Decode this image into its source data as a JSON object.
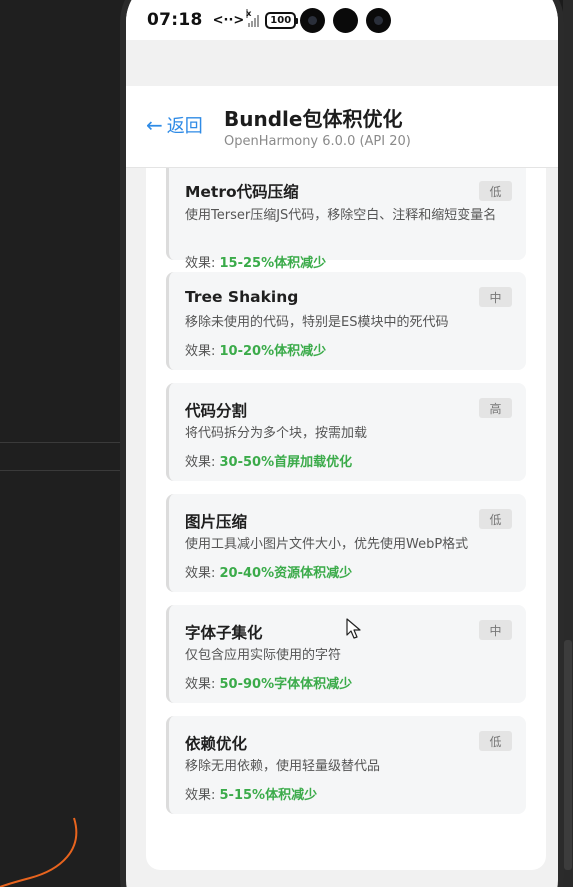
{
  "status_bar": {
    "time": "07:18",
    "nfc_icon": "<··>",
    "battery": "100"
  },
  "header": {
    "back_label": "返回",
    "title": "Bundle包体积优化",
    "subtitle": "OpenHarmony 6.0.0 (API 20)"
  },
  "effect_prefix": "效果: ",
  "items": [
    {
      "title": "Metro代码压缩",
      "badge": "低",
      "description": "使用Terser压缩JS代码，移除空白、注释和缩短变量名",
      "effect": "15-25%体积减少"
    },
    {
      "title": "Tree Shaking",
      "badge": "中",
      "description": "移除未使用的代码，特别是ES模块中的死代码",
      "effect": "10-20%体积减少"
    },
    {
      "title": "代码分割",
      "badge": "高",
      "description": "将代码拆分为多个块，按需加载",
      "effect": "30-50%首屏加载优化"
    },
    {
      "title": "图片压缩",
      "badge": "低",
      "description": "使用工具减小图片文件大小，优先使用WebP格式",
      "effect": "20-40%资源体积减少"
    },
    {
      "title": "字体子集化",
      "badge": "中",
      "description": "仅包含应用实际使用的字符",
      "effect": "50-90%字体体积减少"
    },
    {
      "title": "依赖优化",
      "badge": "低",
      "description": "移除无用依赖，使用轻量级替代品",
      "effect": "5-15%体积减少"
    }
  ],
  "colors": {
    "accent": "#2f8be6",
    "effect_green": "#3bab4a",
    "badge_bg": "#e4e4e4"
  }
}
